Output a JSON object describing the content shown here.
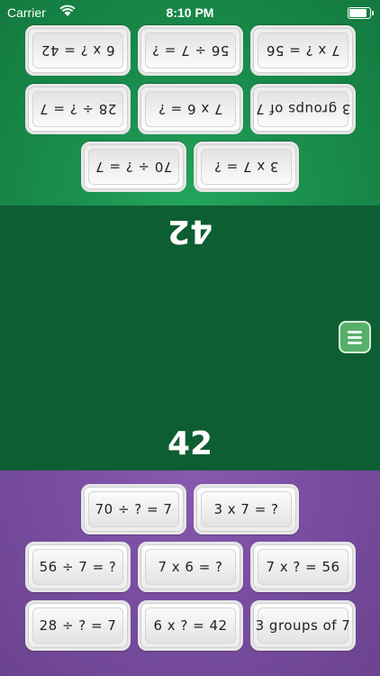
{
  "status_bar": {
    "carrier": "Carrier",
    "time": "8:10 PM"
  },
  "top_player": {
    "answer": "42",
    "cards": [
      "6 x ? = 42",
      "56 ÷ 7 = ?",
      "7 x ? = 56",
      "28 ÷ ? = 7",
      "7 x 6 = ?",
      "3 groups of 7",
      "70 ÷ ? = 7",
      "3 x 7 = ?"
    ]
  },
  "bottom_player": {
    "answer": "42",
    "cards": [
      "70 ÷ ? = 7",
      "3 x 7 = ?",
      "56 ÷ 7 = ?",
      "7 x 6 = ?",
      "7 x ? = 56",
      "28 ÷ ? = 7",
      "6 x ? = 42",
      "3 groups of 7"
    ]
  },
  "colors": {
    "top": "#1a8f4d",
    "middle": "#0e5e33",
    "bottom": "#7a4ea3"
  },
  "icons": {
    "menu": "hamburger-menu-icon",
    "wifi": "wifi-icon",
    "battery": "battery-icon"
  }
}
